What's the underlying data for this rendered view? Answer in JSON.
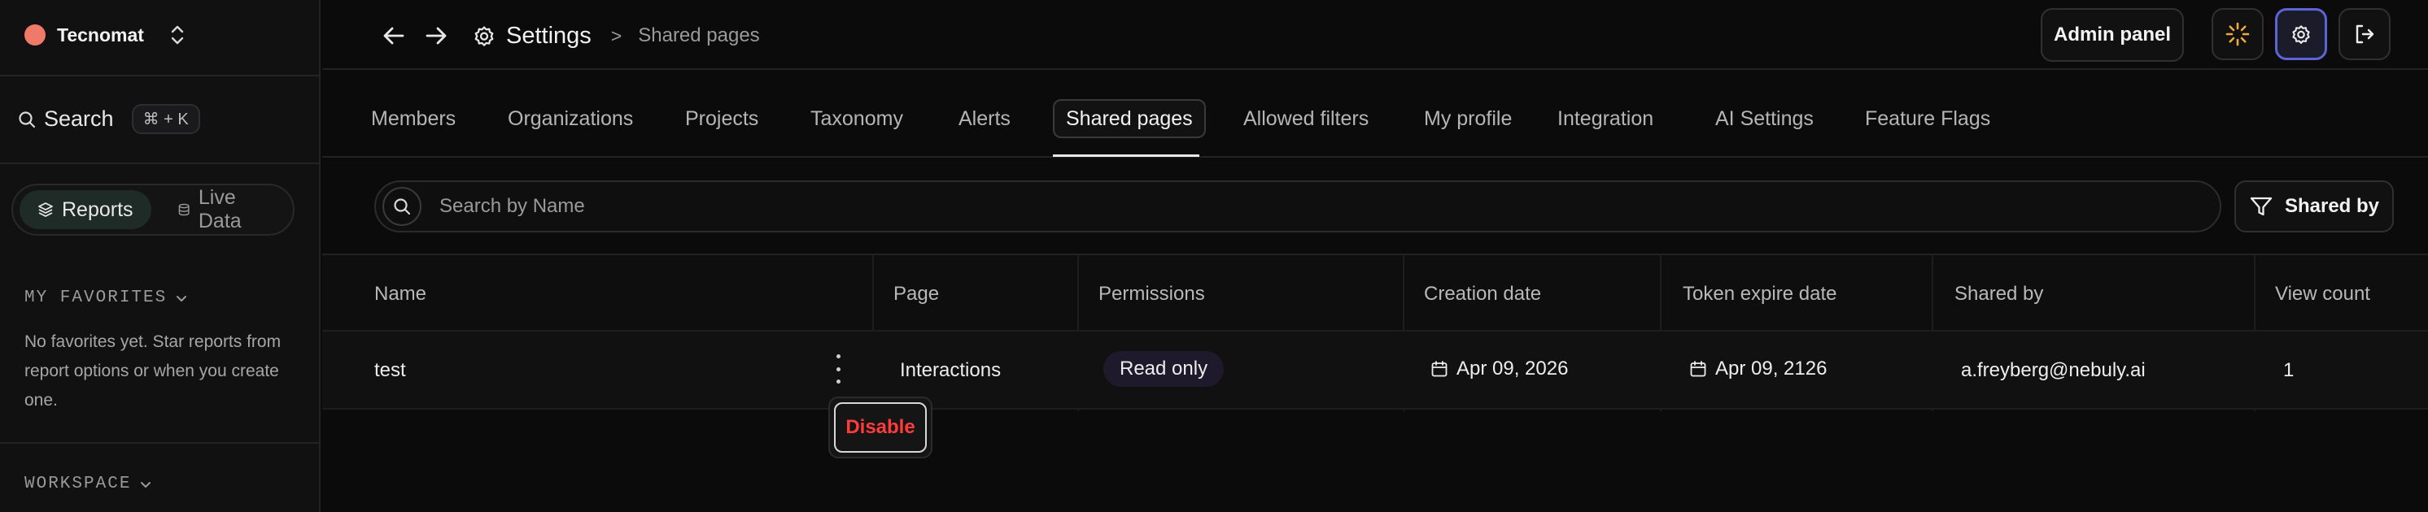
{
  "sidebar": {
    "org_name": "Tecnomat",
    "search_label": "Search",
    "search_shortcut": "⌘ + K",
    "toggle": [
      {
        "label": "Reports",
        "active": true
      },
      {
        "label": "Live Data",
        "active": false
      }
    ],
    "favorites_title": "MY FAVORITES",
    "favorites_empty": "No favorites yet. Star reports from report options or when you create one.",
    "workspace_title": "WORKSPACE"
  },
  "header": {
    "title": "Settings",
    "separator": ">",
    "subtitle": "Shared pages",
    "admin_label": "Admin panel"
  },
  "tabs": [
    {
      "label": "Members"
    },
    {
      "label": "Organizations"
    },
    {
      "label": "Projects"
    },
    {
      "label": "Taxonomy"
    },
    {
      "label": "Alerts"
    },
    {
      "label": "Shared pages",
      "active": true
    },
    {
      "label": "Allowed filters"
    },
    {
      "label": "My profile"
    },
    {
      "label": "Integration"
    },
    {
      "label": "AI Settings"
    },
    {
      "label": "Feature Flags"
    }
  ],
  "search": {
    "placeholder": "Search by Name",
    "value": ""
  },
  "filter": {
    "label": "Shared by"
  },
  "table": {
    "headers": [
      "Name",
      "Page",
      "Permissions",
      "Creation date",
      "Token expire date",
      "Shared by",
      "View count"
    ],
    "rows": [
      {
        "name": "test",
        "page": "Interactions",
        "permissions": "Read only",
        "creation_date": "Apr 09, 2026",
        "token_expire_date": "Apr 09, 2126",
        "shared_by": "a.freyberg@nebuly.ai",
        "view_count": "1"
      }
    ]
  },
  "row_menu": {
    "disable_label": "Disable"
  },
  "colors": {
    "accent": "#5d64d6",
    "danger": "#ff3b3b",
    "brand": "#f07a6a",
    "badge_bg": "#1f1a2b"
  }
}
